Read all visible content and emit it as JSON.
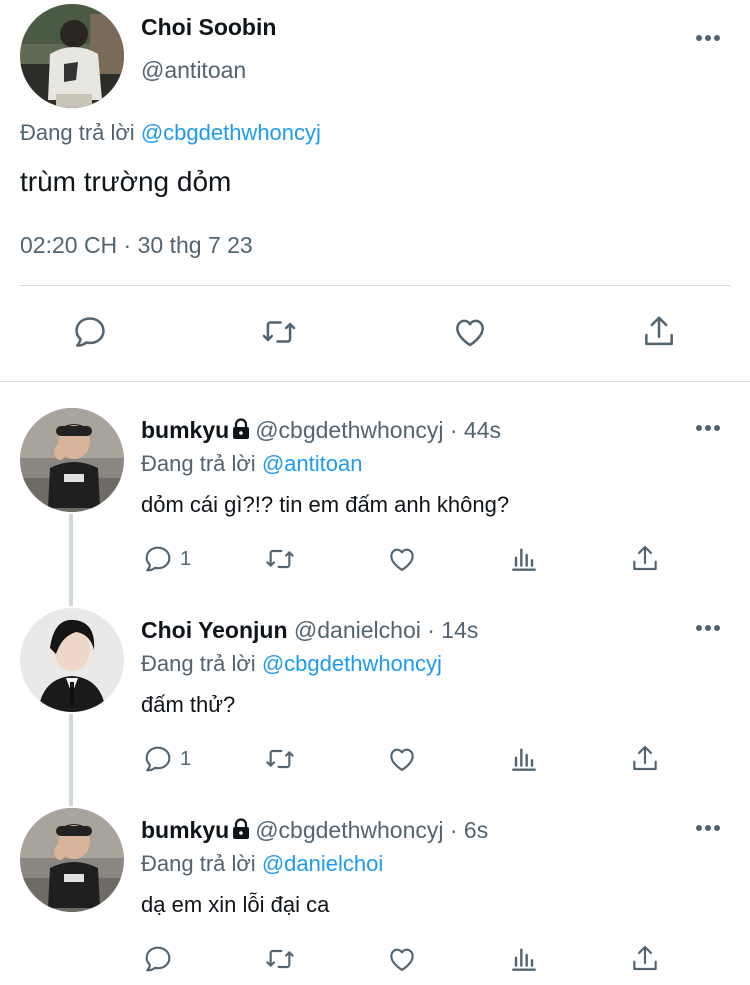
{
  "main_tweet": {
    "display_name": "Choi Soobin",
    "handle": "@antitoan",
    "replying_to_prefix": "Đang trả lời ",
    "replying_to_handle": "@cbgdethwhoncyj",
    "text": "trùm trường dỏm",
    "timestamp": "02:20 CH · 30 thg 7 23",
    "actions": [
      "reply-icon",
      "retweet-icon",
      "like-icon",
      "share-icon"
    ]
  },
  "replies": [
    {
      "display_name": "bumkyu",
      "handle": "@cbgdethwhoncyj",
      "time": " · 44s",
      "protected": true,
      "replying_to_prefix": "Đang trả lời ",
      "replying_to_handle": "@antitoan",
      "text": "dỏm cái gì?!? tin em đấm anh không?",
      "reply_count": "1"
    },
    {
      "display_name": "Choi Yeonjun",
      "handle": "@danielchoi",
      "time": " · 14s",
      "protected": false,
      "replying_to_prefix": "Đang trả lời ",
      "replying_to_handle": "@cbgdethwhoncyj",
      "text": "đấm thử?",
      "reply_count": "1"
    },
    {
      "display_name": "bumkyu",
      "handle": "@cbgdethwhoncyj",
      "time": " · 6s",
      "protected": true,
      "replying_to_prefix": "Đang trả lời ",
      "replying_to_handle": "@danielchoi",
      "text": "dạ em xin lỗi đại ca",
      "reply_count": ""
    }
  ],
  "colors": {
    "link": "#1d9bf0",
    "secondary_text": "#536471",
    "primary_text": "#0f1419",
    "divider": "#cfd9de"
  }
}
